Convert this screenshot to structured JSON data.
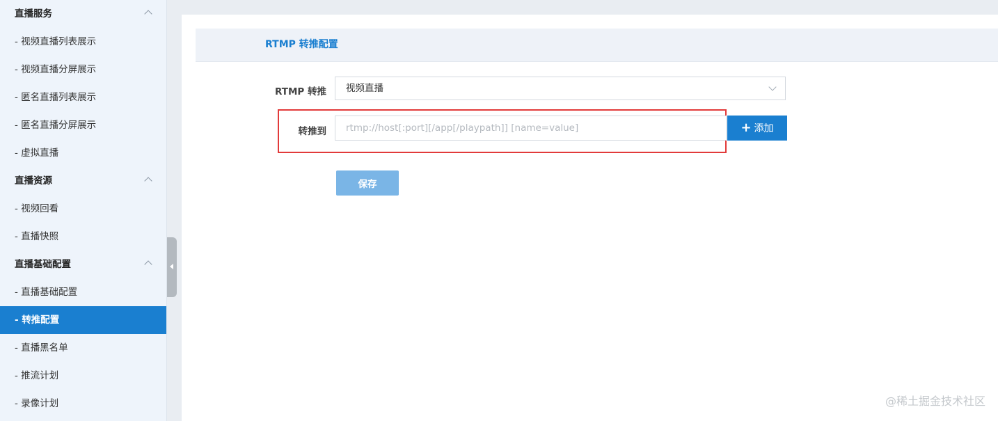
{
  "sidebar": {
    "sections": [
      {
        "title": "直播服务",
        "items": [
          "- 视频直播列表展示",
          "- 视频直播分屏展示",
          "- 匿名直播列表展示",
          "- 匿名直播分屏展示",
          "- 虚拟直播"
        ]
      },
      {
        "title": "直播资源",
        "items": [
          "- 视频回看",
          "- 直播快照"
        ]
      },
      {
        "title": "直播基础配置",
        "items": [
          "- 直播基础配置",
          "- 转推配置",
          "- 直播黑名单",
          "- 推流计划",
          "- 录像计划"
        ]
      }
    ],
    "active_item": "- 转推配置"
  },
  "panel": {
    "title": "RTMP 转推配置"
  },
  "form": {
    "rtmp_label": "RTMP 转推",
    "rtmp_select_value": "视频直播",
    "target_label": "转推到",
    "target_placeholder": "rtmp://host[:port][/app[/playpath]] [name=value]",
    "add_button_label": "添加",
    "add_button_icon": "plus-icon",
    "save_button_label": "保存"
  },
  "watermark": "@稀土掘金技术社区",
  "colors": {
    "accent": "#1a7fd0",
    "save_button": "#7ab5e6",
    "highlight": "#e23a3a",
    "sidebar_bg": "#eef4fb"
  }
}
